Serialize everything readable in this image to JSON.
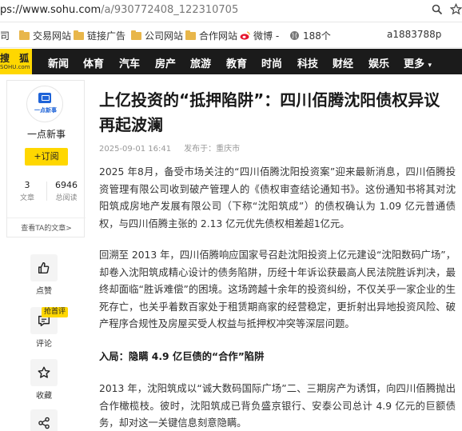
{
  "browser": {
    "url_host": "ps://www.sohu.com",
    "url_path": "/a/930772408_122310705",
    "icons": [
      "search-icon",
      "star-icon"
    ],
    "bookmarks": [
      {
        "label": "司",
        "icon": "folder-icon"
      },
      {
        "label": "交易网站",
        "icon": "folder-icon"
      },
      {
        "label": "链接广告",
        "icon": "folder-icon"
      },
      {
        "label": "公司网站",
        "icon": "folder-icon"
      },
      {
        "label": "合作网站",
        "icon": "folder-icon"
      },
      {
        "label": "微博 -",
        "icon": "weibo-icon"
      },
      {
        "label": "188个",
        "icon": "globe-icon"
      },
      {
        "label": "a1883788p",
        "icon": ""
      }
    ]
  },
  "site": {
    "logo_top": "搜 狐",
    "logo_bottom": "SOHU.com",
    "nav": [
      "新闻",
      "体育",
      "汽车",
      "房产",
      "旅游",
      "教育",
      "时尚",
      "科技",
      "财经",
      "娱乐",
      "更多"
    ]
  },
  "author": {
    "avatar_text": "一点新事",
    "name": "一点新事",
    "subscribe_label": "+订阅",
    "articles_count": "3",
    "articles_label": "文章",
    "views_count": "6946",
    "views_label": "总阅读",
    "more_link": "查看TA的文章>"
  },
  "actions": [
    {
      "label": "点赞",
      "icon": "thumbs-up-icon"
    },
    {
      "label": "评论",
      "icon": "comment-icon",
      "badge": "抢首评"
    },
    {
      "label": "收藏",
      "icon": "star-icon"
    },
    {
      "label": "",
      "icon": "share-icon"
    }
  ],
  "article": {
    "title": "上亿投资的“抵押陷阱”：四川佰腾沈阳债权异议再起波澜",
    "date": "2025-09-01 16:41",
    "source_label": "发布于：",
    "source": "重庆市",
    "paragraphs": [
      "2025 年8月，备受市场关注的“四川佰腾沈阳投资案”迎来最新消息，四川佰腾投资管理有限公司收到破产管理人的《债权审查结论通知书》。这份通知书将其对沈阳筑成房地产发展有限公司（下称“沈阳筑成”）的债权确认为 1.09 亿元普通债权，与四川佰腾主张的 2.13 亿元优先债权相差超1亿元。",
      "回溯至 2013 年，四川佰腾响应国家号召赴沈阳投资上亿元建设“沈阳数码广场”，却卷入沈阳筑成精心设计的债务陷阱，历经十年诉讼获最高人民法院胜诉判决，最终却面临“胜诉难偿”的困境。这场跨越十余年的投资纠纷，不仅关乎一家企业的生死存亡，也关乎着数百家处于租赁期商家的经营稳定，更折射出异地投资风险、破产程序合规性及房屋买受人权益与抵押权冲突等深层问题。",
      "2013 年，沈阳筑成以“诚大数码国际广场”二、三期房产为诱饵，向四川佰腾抛出合作橄榄枝。彼时，沈阳筑成已背负盛京银行、安泰公司总计 4.9 亿元的巨额债务，却对这一关键信息刻意隐瞒。"
    ],
    "subheading": "入局：隐瞒 4.9 亿巨债的“合作”陷阱"
  }
}
